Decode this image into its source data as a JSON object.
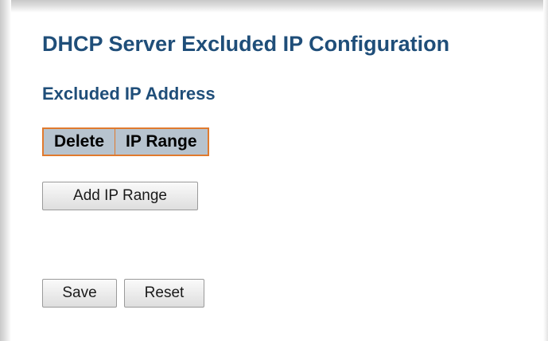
{
  "page": {
    "title": "DHCP Server Excluded IP Configuration",
    "section_title": "Excluded IP Address"
  },
  "table": {
    "columns": [
      "Delete",
      "IP Range"
    ],
    "header_color": "#b7c3ce",
    "border_color": "#e07a2e"
  },
  "buttons": {
    "add_ip_range": "Add IP Range",
    "save": "Save",
    "reset": "Reset"
  },
  "colors": {
    "heading": "#1f4e79"
  }
}
